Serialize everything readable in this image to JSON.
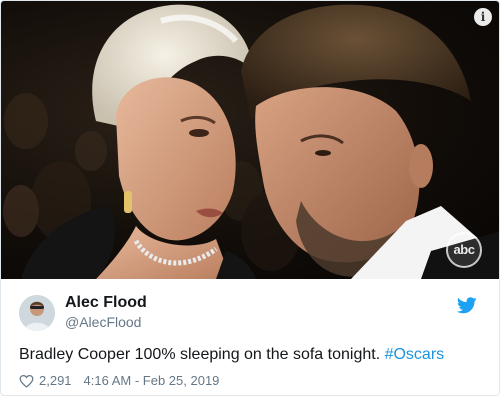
{
  "media": {
    "info_icon": "info-icon",
    "watermark": "abc"
  },
  "tweet": {
    "display_name": "Alec Flood",
    "handle": "@AlecFlood",
    "text": "Bradley Cooper 100% sleeping on the sofa tonight. ",
    "hashtag": "#Oscars",
    "likes": "2,291",
    "timestamp": "4:16 AM - Feb 25, 2019",
    "bird_icon": "twitter-bird-icon",
    "like_icon": "heart-icon",
    "brand_color": "#1DA1F2",
    "hashtag_color": "#1B95E0"
  }
}
